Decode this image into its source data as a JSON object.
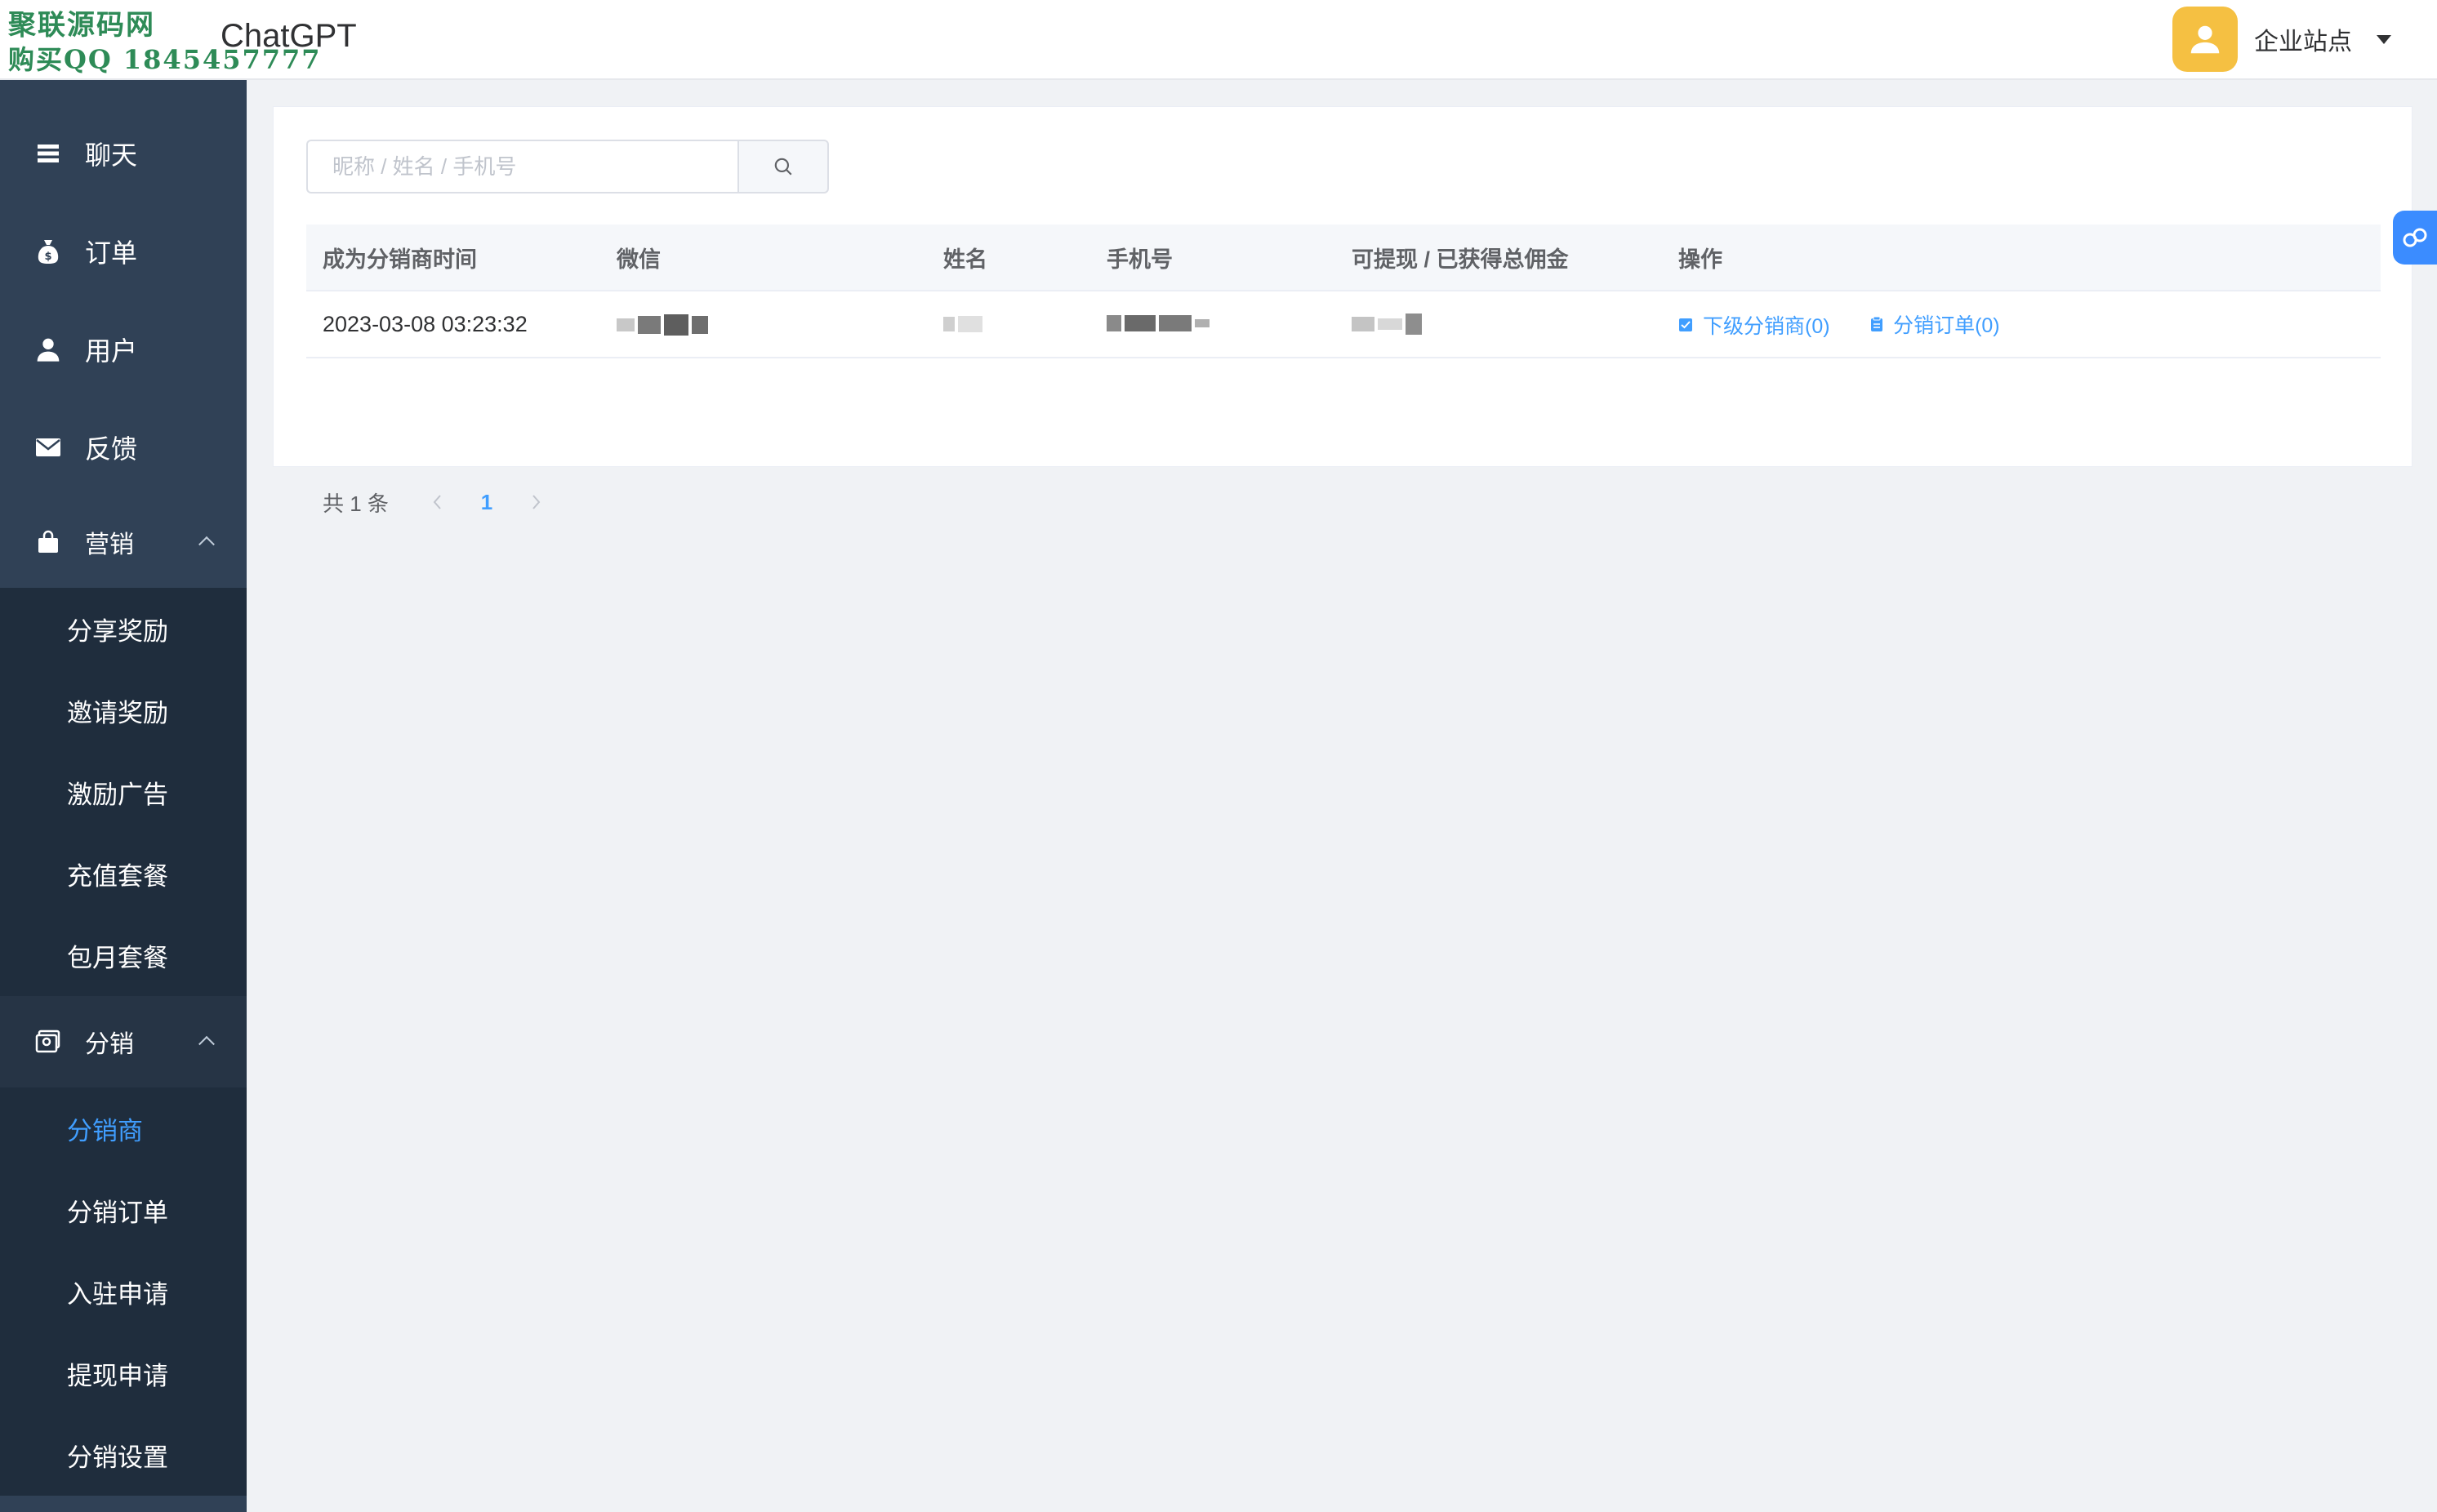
{
  "watermark": {
    "line1": "聚联源码网",
    "line2": "购买QQ 1845457777"
  },
  "header": {
    "app_title": "ChatGPT",
    "site_label": "企业站点"
  },
  "sidebar": {
    "items": [
      {
        "label": "聊天",
        "icon": "menu-lines-icon"
      },
      {
        "label": "订单",
        "icon": "money-bag-icon"
      },
      {
        "label": "用户",
        "icon": "user-icon"
      },
      {
        "label": "反馈",
        "icon": "envelope-icon"
      }
    ],
    "marketing": {
      "label": "营销",
      "icon": "shopping-bag-icon",
      "children": [
        "分享奖励",
        "邀请奖励",
        "激励广告",
        "充值套餐",
        "包月套餐"
      ]
    },
    "distribution": {
      "label": "分销",
      "icon": "distribution-icon",
      "children": [
        "分销商",
        "分销订单",
        "入驻申请",
        "提现申请",
        "分销设置"
      ],
      "active_index": 0
    }
  },
  "search": {
    "placeholder": "昵称 / 姓名 / 手机号",
    "value": ""
  },
  "table": {
    "columns": [
      "成为分销商时间",
      "微信",
      "姓名",
      "手机号",
      "可提现 / 已获得总佣金",
      "操作"
    ],
    "rows": [
      {
        "time": "2023-03-08 03:23:32",
        "actions": [
          "下级分销商(0)",
          "分销订单(0)"
        ]
      }
    ]
  },
  "pagination": {
    "total_text": "共 1 条",
    "current_page": "1"
  },
  "colors": {
    "sidebar_bg": "#304156",
    "submenu_bg": "#1f2d3d",
    "accent": "#409eff",
    "avatar_bg": "#f5c042",
    "watermark": "#2e8b57"
  }
}
